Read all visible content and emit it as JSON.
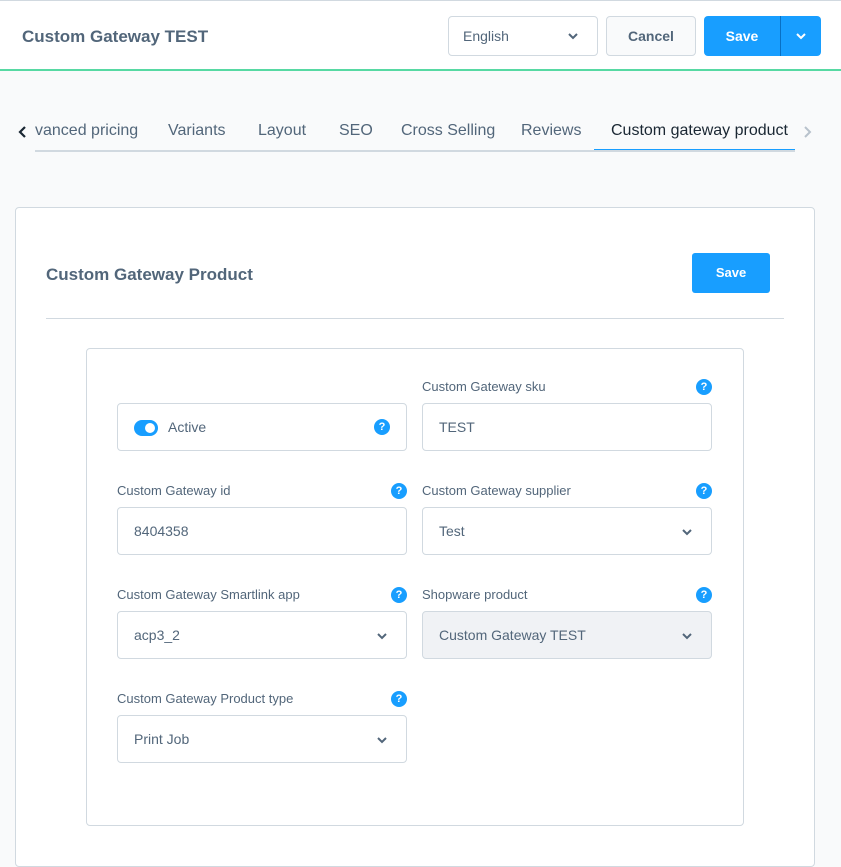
{
  "header": {
    "title": "Custom Gateway TEST",
    "language_select": {
      "value": "English"
    },
    "cancel_label": "Cancel",
    "save_label": "Save"
  },
  "tabs": {
    "items": [
      {
        "label": "vanced pricing",
        "active": false
      },
      {
        "label": "Variants",
        "active": false
      },
      {
        "label": "Layout",
        "active": false
      },
      {
        "label": "SEO",
        "active": false
      },
      {
        "label": "Cross Selling",
        "active": false
      },
      {
        "label": "Reviews",
        "active": false
      },
      {
        "label": "Custom gateway product",
        "active": true
      }
    ]
  },
  "card": {
    "title": "Custom Gateway Product",
    "save_label": "Save",
    "fields": {
      "active": {
        "label": "Active",
        "checked": true
      },
      "sku": {
        "label": "Custom Gateway sku",
        "value": "TEST"
      },
      "id": {
        "label": "Custom Gateway id",
        "value": "8404358"
      },
      "supplier": {
        "label": "Custom Gateway supplier",
        "value": "Test"
      },
      "smartlink": {
        "label": "Custom Gateway Smartlink app",
        "value": "acp3_2"
      },
      "shopware_product": {
        "label": "Shopware product",
        "value": "Custom Gateway TEST",
        "disabled": true
      },
      "product_type": {
        "label": "Custom Gateway Product type",
        "value": "Print Job"
      }
    },
    "help_glyph": "?"
  },
  "colors": {
    "accent": "#189eff",
    "header_border": "#57d9a3",
    "text": "#52667a",
    "border": "#d1d9e0"
  }
}
